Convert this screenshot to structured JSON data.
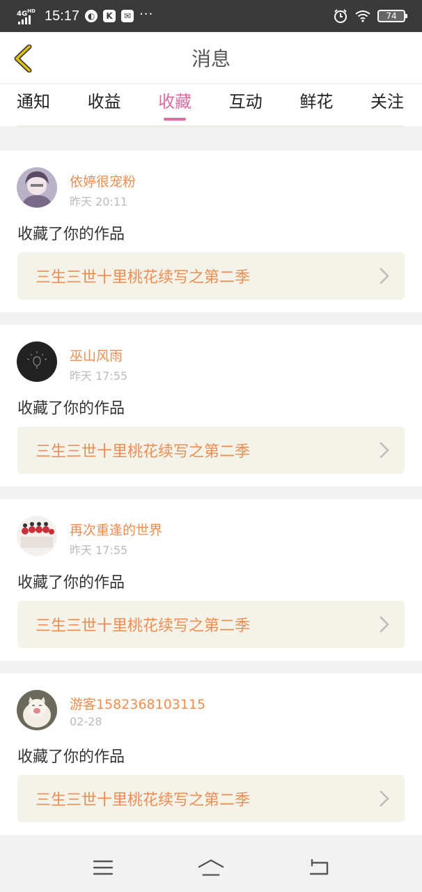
{
  "status_bar": {
    "network": "4G",
    "network_sub": "HD",
    "time": "15:17",
    "app_icons": [
      "browser-icon",
      "k-app-icon",
      "message-app-icon"
    ],
    "more": "···",
    "battery": "74"
  },
  "header": {
    "title": "消息"
  },
  "tabs": [
    {
      "label": "通知",
      "active": false
    },
    {
      "label": "收益",
      "active": false
    },
    {
      "label": "收藏",
      "active": true
    },
    {
      "label": "互动",
      "active": false
    },
    {
      "label": "鲜花",
      "active": false
    },
    {
      "label": "关注",
      "active": false
    }
  ],
  "messages": [
    {
      "user": "依婷很宠粉",
      "time": "昨天 20:11",
      "action": "收藏了你的作品",
      "work": "三生三世十里桃花续写之第二季"
    },
    {
      "user": "巫山风雨",
      "time": "昨天 17:55",
      "action": "收藏了你的作品",
      "work": "三生三世十里桃花续写之第二季"
    },
    {
      "user": "再次重逢的世界",
      "time": "昨天 17:55",
      "action": "收藏了你的作品",
      "work": "三生三世十里桃花续写之第二季"
    },
    {
      "user": "游客1582368103115",
      "time": "02-28",
      "action": "收藏了你的作品",
      "work": "三生三世十里桃花续写之第二季"
    }
  ],
  "colors": {
    "accent": "#e06aa2",
    "username": "#f08c50",
    "work_bg": "#f4f3ea",
    "back_arrow": "#e0c200"
  }
}
